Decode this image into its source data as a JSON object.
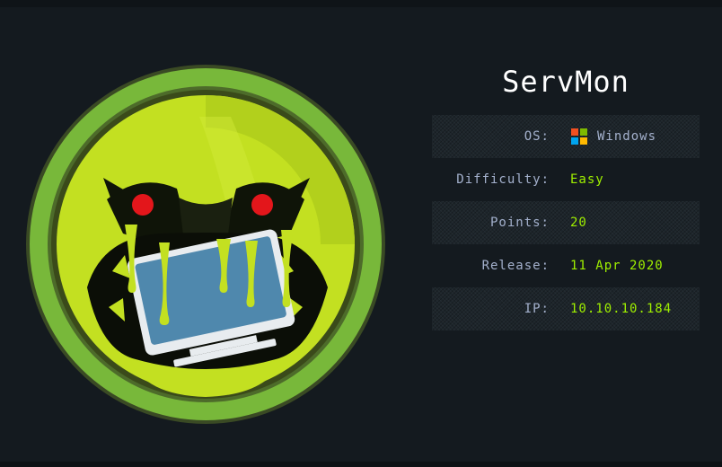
{
  "machine": {
    "name": "ServMon"
  },
  "info_rows": [
    {
      "label": "OS:",
      "value": "Windows",
      "icon": "windows-logo-icon"
    },
    {
      "label": "Difficulty:",
      "value": "Easy"
    },
    {
      "label": "Points:",
      "value": "20"
    },
    {
      "label": "Release:",
      "value": "11 Apr 2020"
    },
    {
      "label": "IP:",
      "value": "10.10.10.184"
    }
  ],
  "colors": {
    "background": "#141a1f",
    "accent_green": "#9fef00",
    "label_blue": "#a4b1cd",
    "badge_ring": "#86c232",
    "badge_face": "#c3e021"
  }
}
